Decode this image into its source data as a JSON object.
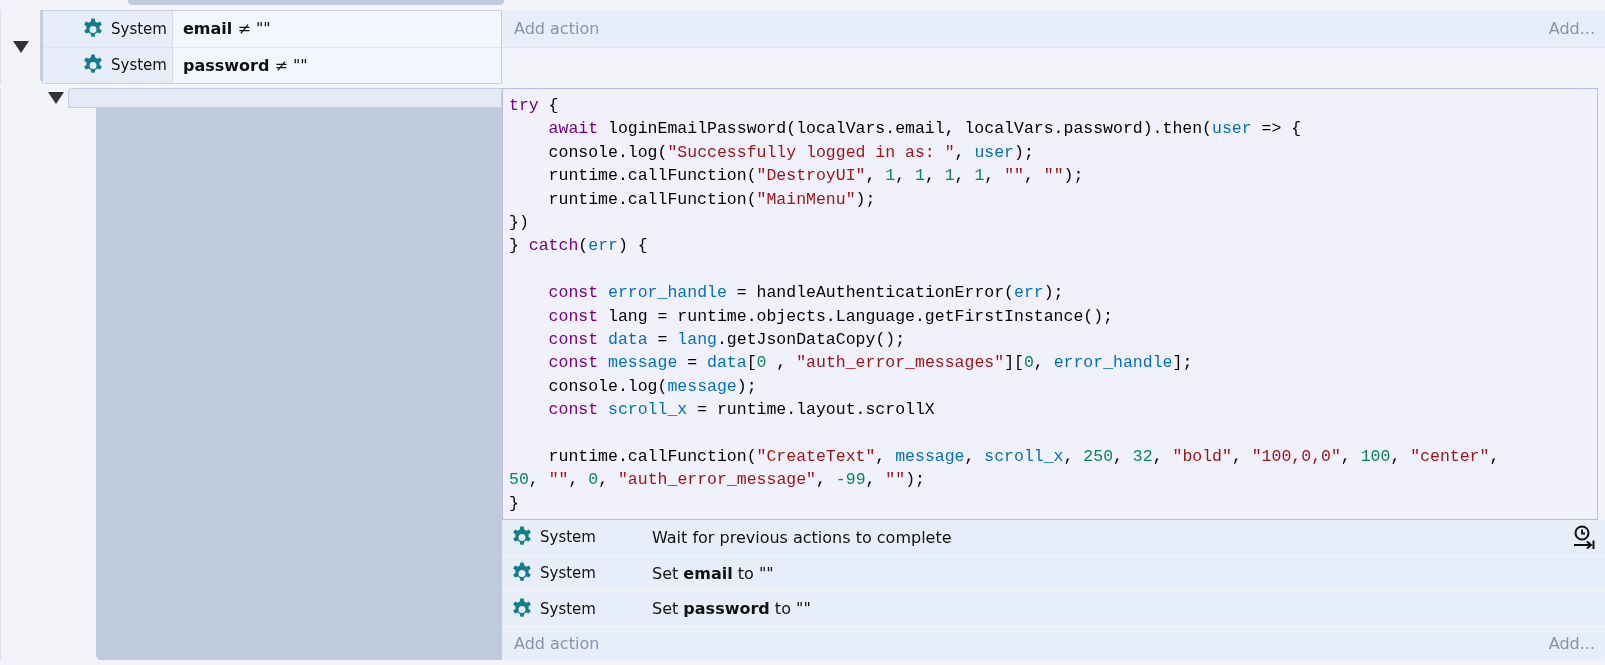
{
  "event": {
    "expanded": true,
    "conditions": [
      {
        "object": "System",
        "text": "**email** ≠ \"\""
      },
      {
        "object": "System",
        "text": "**password** ≠ \"\""
      }
    ],
    "add_action": "Add action",
    "add_more": "Add..."
  },
  "sub_event": {
    "expanded": true,
    "script": [
      {
        "kind": "code",
        "indent": false,
        "tokens": [
          {
            "kind": "kw",
            "text": "try"
          },
          {
            "kind": "plain",
            "text": " {"
          }
        ]
      },
      {
        "kind": "code",
        "indent": true,
        "tokens": [
          {
            "kind": "kw",
            "text": "await"
          },
          {
            "kind": "plain",
            "text": " loginEmailPassword(localVars.email, localVars.password).then("
          },
          {
            "kind": "var",
            "text": "user"
          },
          {
            "kind": "plain",
            "text": " => {"
          }
        ]
      },
      {
        "kind": "code",
        "indent": true,
        "tokens": [
          {
            "kind": "plain",
            "text": "console.log("
          },
          {
            "kind": "str",
            "text": "\"Successfully logged in as: \""
          },
          {
            "kind": "plain",
            "text": ", "
          },
          {
            "kind": "var",
            "text": "user"
          },
          {
            "kind": "plain",
            "text": ");"
          }
        ]
      },
      {
        "kind": "code",
        "indent": true,
        "tokens": [
          {
            "kind": "plain",
            "text": "runtime.callFunction("
          },
          {
            "kind": "str",
            "text": "\"DestroyUI\""
          },
          {
            "kind": "plain",
            "text": ", "
          },
          {
            "kind": "num",
            "text": "1"
          },
          {
            "kind": "plain",
            "text": ", "
          },
          {
            "kind": "num",
            "text": "1"
          },
          {
            "kind": "plain",
            "text": ", "
          },
          {
            "kind": "num",
            "text": "1"
          },
          {
            "kind": "plain",
            "text": ", "
          },
          {
            "kind": "num",
            "text": "1"
          },
          {
            "kind": "plain",
            "text": ", "
          },
          {
            "kind": "str",
            "text": "\"\""
          },
          {
            "kind": "plain",
            "text": ", "
          },
          {
            "kind": "str",
            "text": "\"\""
          },
          {
            "kind": "plain",
            "text": ");"
          }
        ]
      },
      {
        "kind": "code",
        "indent": true,
        "tokens": [
          {
            "kind": "plain",
            "text": "runtime.callFunction("
          },
          {
            "kind": "str",
            "text": "\"MainMenu\""
          },
          {
            "kind": "plain",
            "text": ");"
          }
        ]
      },
      {
        "kind": "code",
        "indent": false,
        "tokens": [
          {
            "kind": "plain",
            "text": "})"
          }
        ]
      },
      {
        "kind": "code",
        "indent": false,
        "tokens": [
          {
            "kind": "plain",
            "text": "} "
          },
          {
            "kind": "kw",
            "text": "catch"
          },
          {
            "kind": "plain",
            "text": "("
          },
          {
            "kind": "var",
            "text": "err"
          },
          {
            "kind": "plain",
            "text": ") {"
          }
        ]
      },
      {
        "kind": "blank"
      },
      {
        "kind": "code",
        "indent": true,
        "tokens": [
          {
            "kind": "kw",
            "text": "const "
          },
          {
            "kind": "var",
            "text": "error_handle"
          },
          {
            "kind": "plain",
            "text": " = handleAuthenticationError("
          },
          {
            "kind": "var",
            "text": "err"
          },
          {
            "kind": "plain",
            "text": ");"
          }
        ]
      },
      {
        "kind": "code",
        "indent": true,
        "tokens": [
          {
            "kind": "kw",
            "text": "const"
          },
          {
            "kind": "plain",
            "text": " lang = runtime.objects.Language.getFirstInstance();"
          }
        ]
      },
      {
        "kind": "code",
        "indent": true,
        "tokens": [
          {
            "kind": "kw",
            "text": "const "
          },
          {
            "kind": "var",
            "text": "data"
          },
          {
            "kind": "plain",
            "text": " = "
          },
          {
            "kind": "var",
            "text": "lang"
          },
          {
            "kind": "plain",
            "text": ".getJsonDataCopy();"
          }
        ]
      },
      {
        "kind": "code",
        "indent": true,
        "tokens": [
          {
            "kind": "kw",
            "text": "const "
          },
          {
            "kind": "var",
            "text": "message"
          },
          {
            "kind": "plain",
            "text": " = "
          },
          {
            "kind": "var",
            "text": "data"
          },
          {
            "kind": "plain",
            "text": "["
          },
          {
            "kind": "num",
            "text": "0"
          },
          {
            "kind": "plain",
            "text": " , "
          },
          {
            "kind": "str",
            "text": "\"auth_error_messages\""
          },
          {
            "kind": "plain",
            "text": "]["
          },
          {
            "kind": "num",
            "text": "0"
          },
          {
            "kind": "plain",
            "text": ", "
          },
          {
            "kind": "var",
            "text": "error_handle"
          },
          {
            "kind": "plain",
            "text": "];"
          }
        ]
      },
      {
        "kind": "code",
        "indent": true,
        "tokens": [
          {
            "kind": "plain",
            "text": "console.log("
          },
          {
            "kind": "var",
            "text": "message"
          },
          {
            "kind": "plain",
            "text": ");"
          }
        ]
      },
      {
        "kind": "code",
        "indent": true,
        "tokens": [
          {
            "kind": "kw",
            "text": "const "
          },
          {
            "kind": "var",
            "text": "scroll_x"
          },
          {
            "kind": "plain",
            "text": " = runtime.layout.scrollX"
          }
        ]
      },
      {
        "kind": "blank"
      },
      {
        "kind": "code",
        "indent": true,
        "tokens": [
          {
            "kind": "plain",
            "text": "runtime.callFunction("
          },
          {
            "kind": "str",
            "text": "\"CreateText\""
          },
          {
            "kind": "plain",
            "text": ", "
          },
          {
            "kind": "var",
            "text": "message"
          },
          {
            "kind": "plain",
            "text": ", "
          },
          {
            "kind": "var",
            "text": "scroll_x"
          },
          {
            "kind": "plain",
            "text": ", "
          },
          {
            "kind": "num",
            "text": "250"
          },
          {
            "kind": "plain",
            "text": ", "
          },
          {
            "kind": "num",
            "text": "32"
          },
          {
            "kind": "plain",
            "text": ", "
          },
          {
            "kind": "str",
            "text": "\"bold\""
          },
          {
            "kind": "plain",
            "text": ", "
          },
          {
            "kind": "str",
            "text": "\"100,0,0\""
          },
          {
            "kind": "plain",
            "text": ", "
          },
          {
            "kind": "num",
            "text": "100"
          },
          {
            "kind": "plain",
            "text": ", "
          },
          {
            "kind": "str",
            "text": "\"center\""
          },
          {
            "kind": "plain",
            "text": ","
          }
        ]
      },
      {
        "kind": "code",
        "indent": false,
        "tokens": [
          {
            "kind": "num",
            "text": "50"
          },
          {
            "kind": "plain",
            "text": ", "
          },
          {
            "kind": "str",
            "text": "\"\""
          },
          {
            "kind": "plain",
            "text": ", "
          },
          {
            "kind": "num",
            "text": "0"
          },
          {
            "kind": "plain",
            "text": ", "
          },
          {
            "kind": "str",
            "text": "\"auth_error_message\""
          },
          {
            "kind": "plain",
            "text": ", "
          },
          {
            "kind": "num",
            "text": "-99"
          },
          {
            "kind": "plain",
            "text": ", "
          },
          {
            "kind": "str",
            "text": "\"\""
          },
          {
            "kind": "plain",
            "text": ");"
          }
        ]
      },
      {
        "kind": "code",
        "indent": false,
        "tokens": [
          {
            "kind": "plain",
            "text": "}"
          }
        ]
      }
    ],
    "actions": [
      {
        "object": "System",
        "text": "Wait for previous actions to complete",
        "waits": true
      },
      {
        "object": "System",
        "text": "Set **email** to \"\"",
        "waits": false
      },
      {
        "object": "System",
        "text": "Set **password** to \"\"",
        "waits": false
      }
    ],
    "add_action": "Add action",
    "add_more": "Add..."
  }
}
